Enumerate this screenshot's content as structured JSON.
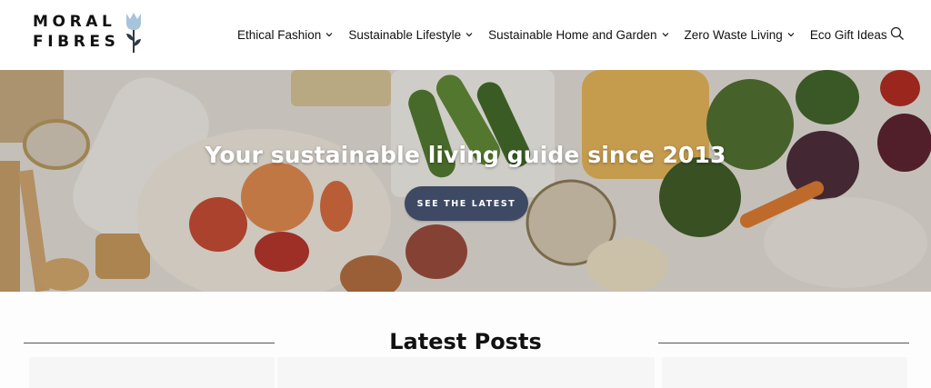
{
  "header": {
    "logo": {
      "line1": "MORAL",
      "line2": "FIBRES",
      "icon": "tulip-icon",
      "color": "#111111",
      "icon_color": "#a8c4dc"
    },
    "nav": [
      {
        "label": "Ethical Fashion",
        "has_dropdown": true
      },
      {
        "label": "Sustainable Lifestyle",
        "has_dropdown": true
      },
      {
        "label": "Sustainable Home and Garden",
        "has_dropdown": true
      },
      {
        "label": "Zero Waste Living",
        "has_dropdown": true
      },
      {
        "label": "Eco Gift Ideas",
        "has_dropdown": false
      }
    ],
    "search_icon": "search-icon"
  },
  "hero": {
    "title": "Your sustainable living guide since 2013",
    "button_label": "SEE THE LATEST",
    "button_color": "#3e4a64"
  },
  "latest": {
    "title": "Latest Posts"
  }
}
